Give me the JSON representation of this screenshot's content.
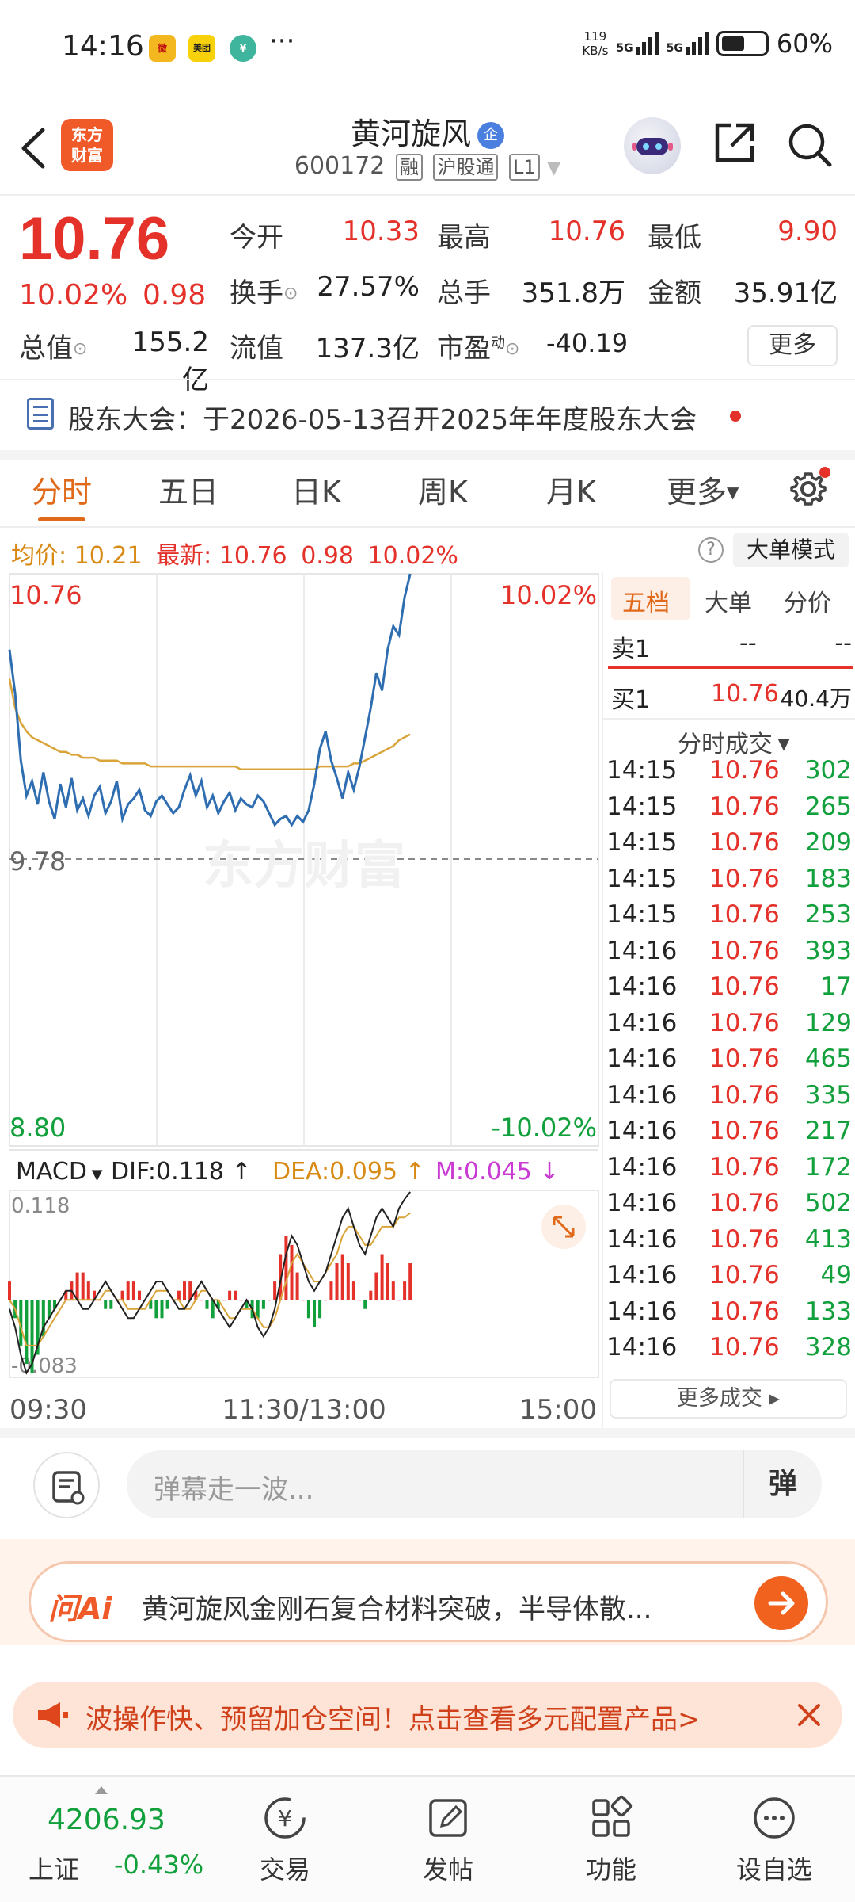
{
  "status_bar": {
    "time": "14:16",
    "app_icons": [
      {
        "name": "weibo-icon",
        "label": "微",
        "color": "#f3b81f"
      },
      {
        "name": "meituan-icon",
        "label": "美团",
        "color": "#f7d10a"
      },
      {
        "name": "bank-icon",
        "label": "¥",
        "color": "#3fb59e"
      }
    ],
    "more": "···",
    "net_speed_value": "119",
    "net_speed_unit": "KB/s",
    "sim1": "5G",
    "sim2": "5G",
    "battery": "60%"
  },
  "header": {
    "logo_line1": "东方",
    "logo_line2": "财富",
    "stock_name": "黄河旋风",
    "badge": "企",
    "stock_code": "600172",
    "tag_margin": "融",
    "tag_connect": "沪股通",
    "tag_level": "L1"
  },
  "quote": {
    "price": "10.76",
    "change_pct": "10.02%",
    "change_abs": "0.98",
    "open_label": "今开",
    "open": "10.33",
    "high_label": "最高",
    "high": "10.76",
    "low_label": "最低",
    "low": "9.90",
    "turnover_label": "换手",
    "turnover": "27.57%",
    "volume_label": "总手",
    "volume": "351.8万",
    "amount_label": "金额",
    "amount": "35.91亿",
    "mktcap_label": "总值",
    "mktcap": "155.2亿",
    "float_label": "流值",
    "float": "137.3亿",
    "pe_label": "市盈",
    "pe_sup": "动",
    "pe": "-40.19",
    "more": "更多"
  },
  "notice": {
    "text": "股东大会：于2026-05-13召开2025年年度股东大会"
  },
  "tabs": [
    "分时",
    "五日",
    "日K",
    "周K",
    "月K",
    "更多"
  ],
  "chart_info": {
    "avg_label": "均价:",
    "avg": "10.21",
    "latest_label": "最新:",
    "latest": "10.76",
    "chg": "0.98",
    "pct": "10.02%",
    "help": "?",
    "mode_button": "大单模式"
  },
  "chart_data": {
    "type": "line",
    "price_axis": {
      "top": "10.76",
      "mid": "9.78",
      "bottom": "8.80",
      "top_pct": "10.02%",
      "bottom_pct": "-10.02%"
    },
    "ylim": [
      8.8,
      10.76
    ],
    "prev_close": 9.78,
    "x_labels": [
      "09:30",
      "11:30/13:00",
      "15:00"
    ],
    "watermark": "东方财富",
    "price": [
      10.5,
      10.35,
      10.12,
      10.0,
      10.05,
      9.97,
      10.08,
      9.98,
      9.92,
      10.04,
      9.96,
      10.06,
      9.95,
      9.99,
      9.93,
      10.0,
      10.03,
      9.94,
      9.98,
      10.05,
      9.92,
      9.97,
      9.99,
      10.02,
      9.95,
      9.93,
      9.98,
      10.0,
      9.97,
      9.94,
      9.96,
      10.02,
      10.07,
      10.0,
      10.05,
      9.96,
      10.0,
      9.94,
      9.98,
      10.01,
      9.95,
      9.99,
      9.97,
      9.96,
      10.0,
      9.98,
      9.94,
      9.9,
      9.92,
      9.93,
      9.9,
      9.93,
      9.91,
      9.95,
      10.04,
      10.16,
      10.22,
      10.12,
      10.06,
      9.99,
      10.08,
      10.02,
      10.1,
      10.2,
      10.3,
      10.42,
      10.36,
      10.5,
      10.58,
      10.55,
      10.68,
      10.76
    ],
    "avg": [
      10.4,
      10.3,
      10.25,
      10.22,
      10.2,
      10.19,
      10.18,
      10.17,
      10.16,
      10.15,
      10.15,
      10.14,
      10.14,
      10.13,
      10.13,
      10.13,
      10.12,
      10.12,
      10.12,
      10.12,
      10.11,
      10.11,
      10.11,
      10.11,
      10.11,
      10.1,
      10.1,
      10.1,
      10.1,
      10.1,
      10.1,
      10.1,
      10.1,
      10.1,
      10.1,
      10.1,
      10.1,
      10.1,
      10.1,
      10.1,
      10.1,
      10.09,
      10.09,
      10.09,
      10.09,
      10.09,
      10.09,
      10.09,
      10.09,
      10.09,
      10.09,
      10.09,
      10.09,
      10.09,
      10.09,
      10.1,
      10.1,
      10.1,
      10.1,
      10.1,
      10.1,
      10.11,
      10.11,
      10.12,
      10.13,
      10.14,
      10.15,
      10.16,
      10.17,
      10.19,
      10.2,
      10.21
    ],
    "macd": {
      "label": "MACD",
      "dif_label": "DIF:0.118",
      "dea_label": "DEA:0.095",
      "m_label": "M:0.045",
      "top": "0.118",
      "bottom": "-0.083",
      "ylim": [
        -0.083,
        0.118
      ],
      "bars": [
        0.02,
        -0.02,
        -0.05,
        -0.07,
        -0.08,
        -0.06,
        -0.04,
        -0.02,
        -0.01,
        0.0,
        0.01,
        0.02,
        0.03,
        0.03,
        0.02,
        0.01,
        0.0,
        -0.01,
        -0.01,
        0.0,
        0.01,
        0.02,
        0.02,
        0.01,
        0.0,
        -0.01,
        -0.02,
        -0.02,
        -0.01,
        0.0,
        0.01,
        0.02,
        0.02,
        0.01,
        0.0,
        -0.01,
        -0.02,
        -0.01,
        0.0,
        0.01,
        0.01,
        0.0,
        -0.01,
        -0.02,
        -0.02,
        -0.01,
        0.0,
        0.02,
        0.05,
        0.07,
        0.06,
        0.03,
        0.0,
        -0.02,
        -0.03,
        -0.02,
        0.0,
        0.02,
        0.04,
        0.05,
        0.04,
        0.02,
        0.0,
        -0.01,
        0.01,
        0.03,
        0.05,
        0.04,
        0.02,
        0.0,
        0.02,
        0.04
      ],
      "dif": [
        -0.01,
        -0.03,
        -0.06,
        -0.08,
        -0.07,
        -0.05,
        -0.03,
        -0.02,
        -0.01,
        0.0,
        0.01,
        0.01,
        0.0,
        -0.01,
        -0.01,
        0.0,
        0.01,
        0.02,
        0.01,
        0.0,
        -0.01,
        -0.02,
        -0.02,
        -0.01,
        0.0,
        0.01,
        0.02,
        0.02,
        0.01,
        0.0,
        -0.01,
        -0.01,
        0.0,
        0.01,
        0.02,
        0.01,
        0.0,
        -0.01,
        -0.02,
        -0.03,
        -0.02,
        -0.01,
        0.0,
        -0.01,
        -0.03,
        -0.04,
        -0.03,
        -0.01,
        0.02,
        0.05,
        0.07,
        0.06,
        0.04,
        0.02,
        0.01,
        0.02,
        0.03,
        0.05,
        0.07,
        0.09,
        0.1,
        0.08,
        0.06,
        0.05,
        0.07,
        0.09,
        0.1,
        0.09,
        0.08,
        0.1,
        0.11,
        0.118
      ],
      "dea": [
        0.0,
        -0.01,
        -0.03,
        -0.05,
        -0.05,
        -0.05,
        -0.04,
        -0.03,
        -0.02,
        -0.01,
        0.0,
        0.0,
        0.0,
        0.0,
        0.0,
        0.0,
        0.0,
        0.01,
        0.01,
        0.0,
        0.0,
        -0.01,
        -0.01,
        -0.01,
        -0.01,
        0.0,
        0.01,
        0.01,
        0.01,
        0.0,
        0.0,
        -0.01,
        -0.01,
        0.0,
        0.01,
        0.01,
        0.0,
        0.0,
        -0.01,
        -0.02,
        -0.02,
        -0.01,
        -0.01,
        -0.01,
        -0.02,
        -0.03,
        -0.03,
        -0.02,
        0.0,
        0.02,
        0.04,
        0.05,
        0.04,
        0.03,
        0.02,
        0.02,
        0.03,
        0.04,
        0.05,
        0.07,
        0.08,
        0.08,
        0.07,
        0.06,
        0.06,
        0.07,
        0.08,
        0.08,
        0.08,
        0.09,
        0.09,
        0.095
      ]
    }
  },
  "right_panel": {
    "tabs": [
      "五档",
      "大单",
      "分价"
    ],
    "sell1_label": "卖1",
    "sell1_price": "--",
    "sell1_vol": "--",
    "buy1_label": "买1",
    "buy1_price": "10.76",
    "buy1_vol": "40.4万",
    "trades_title": "分时成交",
    "trades": [
      {
        "t": "14:15",
        "p": "10.76",
        "v": "302"
      },
      {
        "t": "14:15",
        "p": "10.76",
        "v": "265"
      },
      {
        "t": "14:15",
        "p": "10.76",
        "v": "209"
      },
      {
        "t": "14:15",
        "p": "10.76",
        "v": "183"
      },
      {
        "t": "14:15",
        "p": "10.76",
        "v": "253"
      },
      {
        "t": "14:16",
        "p": "10.76",
        "v": "393"
      },
      {
        "t": "14:16",
        "p": "10.76",
        "v": "17"
      },
      {
        "t": "14:16",
        "p": "10.76",
        "v": "129"
      },
      {
        "t": "14:16",
        "p": "10.76",
        "v": "465"
      },
      {
        "t": "14:16",
        "p": "10.76",
        "v": "335"
      },
      {
        "t": "14:16",
        "p": "10.76",
        "v": "217"
      },
      {
        "t": "14:16",
        "p": "10.76",
        "v": "172"
      },
      {
        "t": "14:16",
        "p": "10.76",
        "v": "502"
      },
      {
        "t": "14:16",
        "p": "10.76",
        "v": "413"
      },
      {
        "t": "14:16",
        "p": "10.76",
        "v": "49"
      },
      {
        "t": "14:16",
        "p": "10.76",
        "v": "133"
      },
      {
        "t": "14:16",
        "p": "10.76",
        "v": "328"
      }
    ],
    "more_trades": "更多成交 ▸"
  },
  "comment": {
    "placeholder": "弹幕走一波...",
    "danmaku": "弹"
  },
  "ai": {
    "logo": "问Ai",
    "text": "黄河旋风金刚石复合材料突破，半导体散..."
  },
  "promo": {
    "text": "波操作快、预留加仓空间！点击查看多元配置产品>"
  },
  "bottom_nav": {
    "index_value": "4206.93",
    "index_name": "上证",
    "index_change": "-0.43%",
    "items": [
      "交易",
      "发帖",
      "功能",
      "设自选"
    ]
  },
  "colors": {
    "up": "#e4322b",
    "down": "#12a03c",
    "price_line": "#2f6db1",
    "avg_line": "#d9a43a",
    "accent": "#f05a28"
  }
}
